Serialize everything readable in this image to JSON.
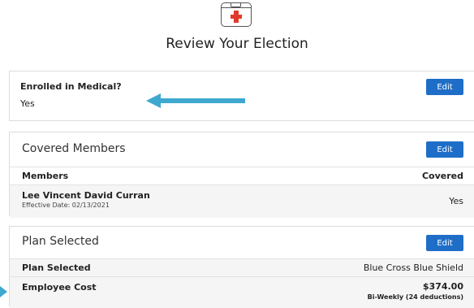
{
  "page": {
    "title": "Review Your Election",
    "icon": "medical-kit-icon"
  },
  "enrollment": {
    "label": "Enrolled in Medical?",
    "value": "Yes",
    "edit_label": "Edit"
  },
  "covered_members": {
    "title": "Covered Members",
    "edit_label": "Edit",
    "columns": [
      "Members",
      "Covered"
    ],
    "rows": [
      {
        "name": "Lee Vincent David Curran",
        "effective": "Effective Date: 02/13/2021",
        "covered": "Yes"
      }
    ]
  },
  "plan": {
    "title": "Plan Selected",
    "edit_label": "Edit",
    "plan_label": "Plan Selected",
    "plan_value": "Blue Cross Blue Shield",
    "cost_label": "Employee Cost",
    "cost_amount": "$374.00",
    "cost_frequency": "Bi-Weekly (24 deductions)"
  },
  "colors": {
    "accent": "#1e6ec8",
    "arrow": "#3ea8cf",
    "cross": "#e23a2a"
  }
}
